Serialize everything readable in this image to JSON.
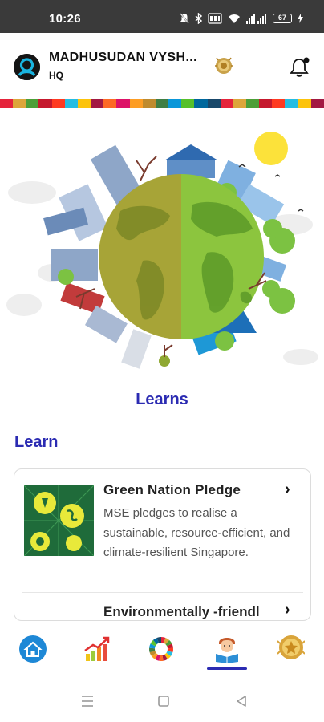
{
  "status_bar": {
    "time": "10:26",
    "battery": "67",
    "icons": [
      "mute-icon",
      "bluetooth-icon",
      "volte-icon",
      "wifi-icon",
      "signal-icon",
      "battery-icon",
      "charging-icon"
    ]
  },
  "header": {
    "user_name": "MADHUSUDAN VYSH...",
    "org": "HQ",
    "icons": [
      "avatar",
      "rank-badge-icon",
      "bell-icon"
    ]
  },
  "colors": {
    "accent": "#2b2bb2",
    "status_bar": "#3a3a3a",
    "sdg_strip": [
      "#e5243b",
      "#dda63a",
      "#4c9f38",
      "#c5192d",
      "#ff3a21",
      "#26bde2",
      "#fcc30b",
      "#a21942",
      "#fd6925",
      "#dd1367",
      "#fd9d24",
      "#bf8b2e",
      "#3f7e44",
      "#0a97d9",
      "#56c02b",
      "#00689d",
      "#19486a",
      "#e5243b",
      "#dda63a",
      "#4c9f38",
      "#c5192d",
      "#ff3a21",
      "#26bde2",
      "#fcc30b",
      "#a21942"
    ]
  },
  "hero": {
    "title": "Learns"
  },
  "section": {
    "title": "Learn"
  },
  "cards": [
    {
      "title": "Green Nation Pledge",
      "description": "MSE pledges to realise a sustainable, resource-efficient, and climate-resilient Singapore.",
      "chevron": "›"
    },
    {
      "title": "Environmentally -friendl",
      "chevron": "›"
    }
  ],
  "bottom_nav": {
    "items": [
      "home-icon",
      "growth-chart-icon",
      "sdg-wheel-icon",
      "learner-icon",
      "award-medal-icon"
    ],
    "active_index": 3
  },
  "system_nav": [
    "menu-icon",
    "home-square-icon",
    "back-triangle-icon"
  ]
}
